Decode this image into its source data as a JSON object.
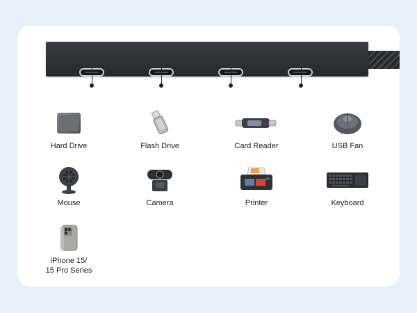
{
  "hub": {
    "ports": [
      "usb-c-port",
      "usb-c-port",
      "usb-c-port",
      "usb-c-port"
    ]
  },
  "devices": [
    {
      "label": "Hard Drive",
      "icon": "hard-drive-icon"
    },
    {
      "label": "Flash Drive",
      "icon": "flash-drive-icon"
    },
    {
      "label": "Card Reader",
      "icon": "card-reader-icon"
    },
    {
      "label": "USB Fan",
      "icon": "usb-fan-icon"
    },
    {
      "label": "Mouse",
      "icon": "mouse-icon"
    },
    {
      "label": "Camera",
      "icon": "camera-icon"
    },
    {
      "label": "Printer",
      "icon": "printer-icon"
    },
    {
      "label": "Keyboard",
      "icon": "keyboard-icon"
    },
    {
      "label": "iPhone 15/\n15 Pro Series",
      "icon": "iphone-icon"
    }
  ],
  "colors": {
    "background": "#e8f0fa",
    "card": "#ffffff",
    "hub": "#2c2e31",
    "text": "#1d1d1f"
  }
}
